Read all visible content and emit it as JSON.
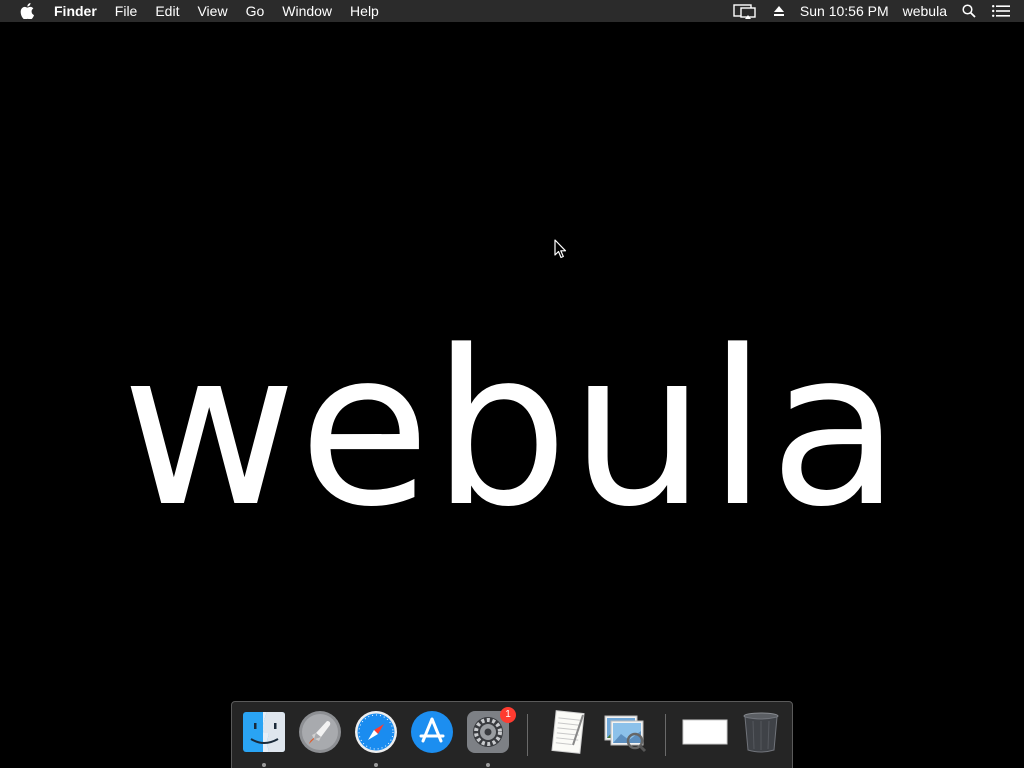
{
  "menubar": {
    "apple_icon": "apple-icon",
    "app_name": "Finder",
    "menus": [
      "File",
      "Edit",
      "View",
      "Go",
      "Window",
      "Help"
    ],
    "status": {
      "display_icon": "airplay-display-icon",
      "eject_icon": "eject-icon",
      "clock": "Sun 10:56 PM",
      "user": "webula",
      "search_icon": "spotlight-search-icon",
      "notifications_icon": "notification-center-icon"
    }
  },
  "desktop": {
    "wallpaper_text": "webula",
    "background_color": "#000000"
  },
  "dock": {
    "items": [
      {
        "name": "finder",
        "icon": "finder-icon",
        "running": true
      },
      {
        "name": "launchpad",
        "icon": "launchpad-rocket-icon",
        "running": false
      },
      {
        "name": "safari",
        "icon": "safari-compass-icon",
        "running": true
      },
      {
        "name": "app-store",
        "icon": "app-store-icon",
        "running": false
      },
      {
        "name": "system-preferences",
        "icon": "gear-icon",
        "running": true,
        "badge": "1"
      },
      {
        "name": "textedit",
        "icon": "textedit-document-icon",
        "running": false
      },
      {
        "name": "preview",
        "icon": "preview-photos-icon",
        "running": false
      },
      {
        "name": "minimized-window",
        "icon": "window-thumbnail-icon",
        "running": false
      },
      {
        "name": "trash",
        "icon": "trash-icon",
        "running": false
      }
    ]
  },
  "colors": {
    "menubar_bg": "#2b2b2b",
    "badge": "#ff3b30",
    "safari_blue": "#1a8cf0",
    "appstore_blue": "#1c8ef0"
  }
}
